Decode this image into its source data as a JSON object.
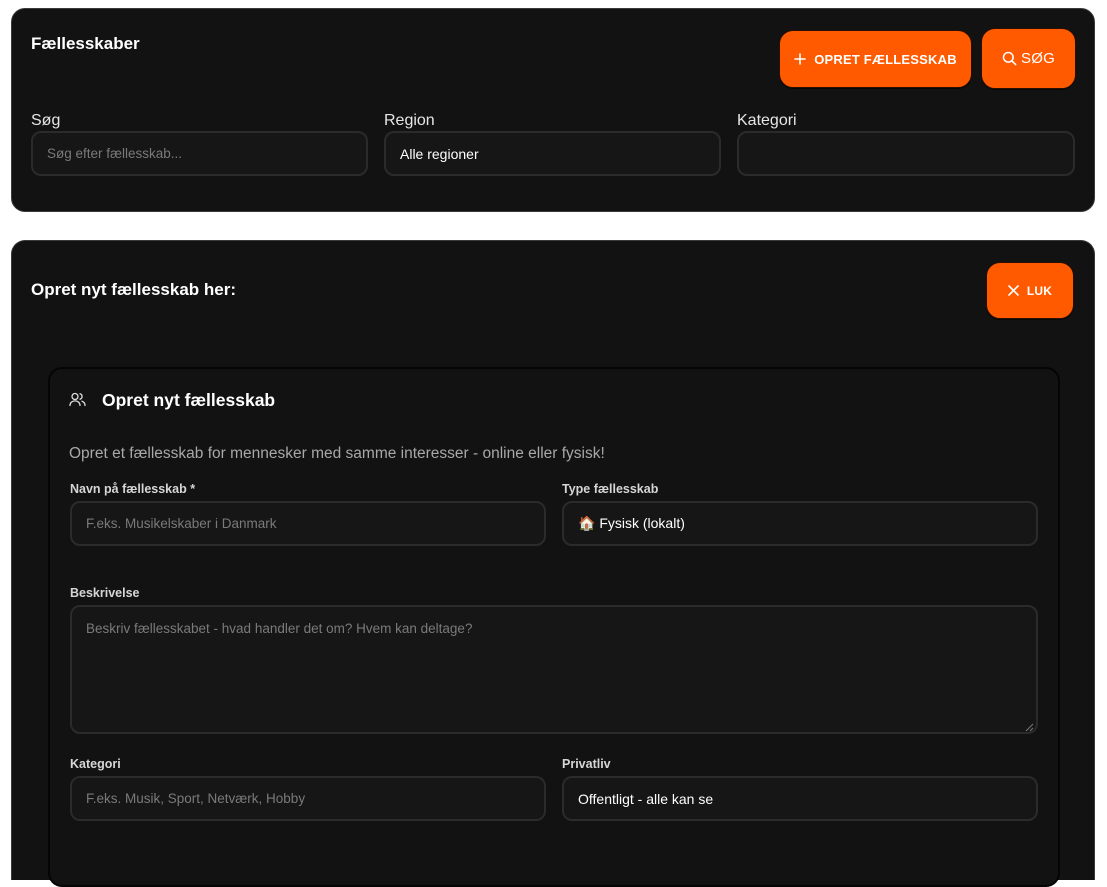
{
  "search_panel": {
    "title": "Fællesskaber",
    "create_button_label": "OPRET FÆLLESSKAB",
    "search_button_label": "SØG",
    "fields": {
      "search": {
        "label": "Søg",
        "placeholder": "Søg efter fællesskab..."
      },
      "region": {
        "label": "Region",
        "value": "Alle regioner"
      },
      "category": {
        "label": "Kategori",
        "value": ""
      }
    }
  },
  "create_panel": {
    "title": "Opret nyt fællesskab her:",
    "close_button_label": "LUK",
    "form": {
      "heading": "Opret nyt fællesskab",
      "description": "Opret et fællesskab for mennesker med samme interesser - online eller fysisk!",
      "name": {
        "label": "Navn på fællesskab *",
        "placeholder": "F.eks. Musikelskaber i Danmark"
      },
      "type": {
        "label": "Type fællesskab",
        "value": "🏠 Fysisk (lokalt)"
      },
      "details": {
        "label": "Beskrivelse",
        "placeholder": "Beskriv fællesskabet - hvad handler det om? Hvem kan deltage?"
      },
      "category": {
        "label": "Kategori",
        "placeholder": "F.eks. Musik, Sport, Netværk, Hobby"
      },
      "privacy": {
        "label": "Privatliv",
        "value": "Offentligt - alle kan se"
      }
    }
  },
  "colors": {
    "accent": "#ff5a00",
    "panel_background": "#121212",
    "field_background": "#161616",
    "field_border": "#2b2b2b",
    "placeholder_text": "#7a7a7a"
  },
  "icons": {
    "create": "plus-icon",
    "search": "search-icon",
    "close": "close-icon",
    "form_heading": "users-icon"
  }
}
